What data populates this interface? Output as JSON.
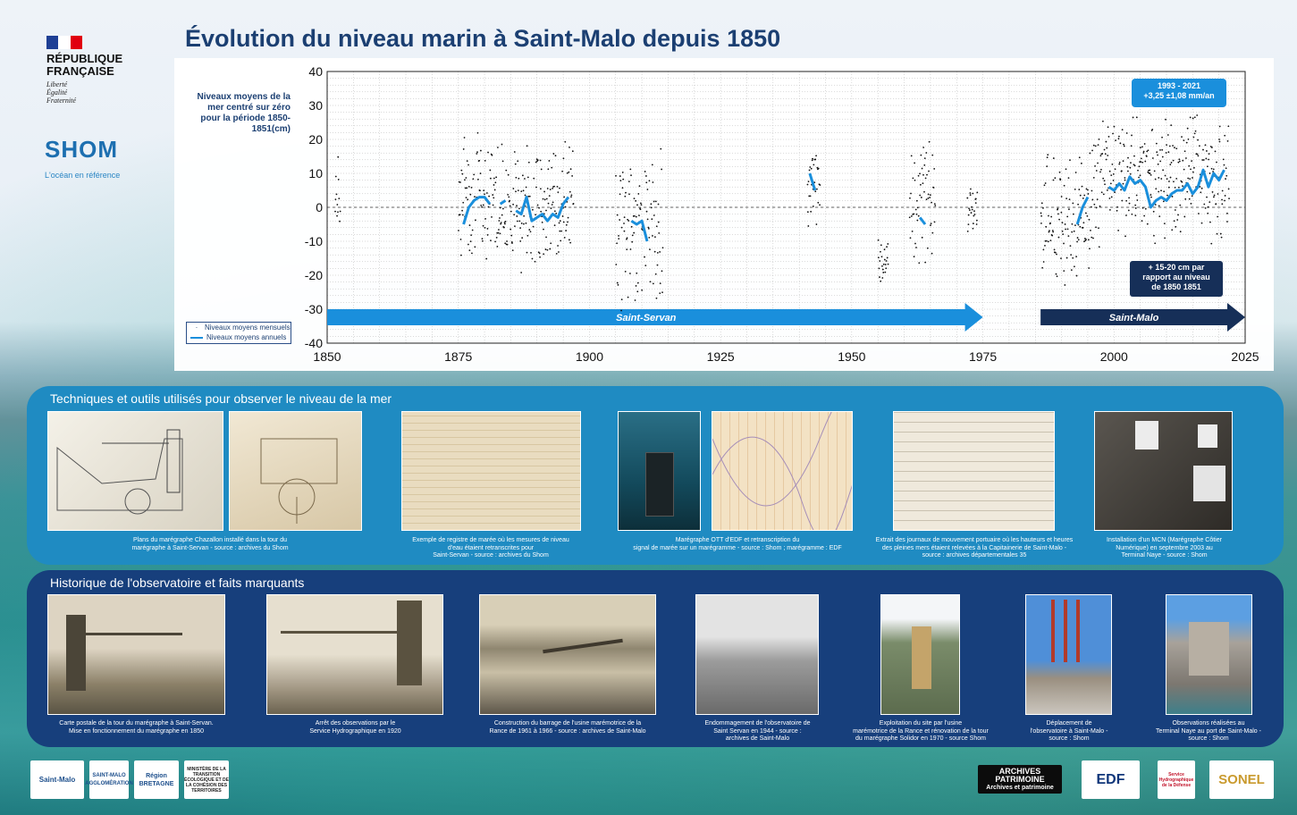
{
  "header": {
    "republique_name": "RÉPUBLIQUE\nFRANÇAISE",
    "motto": "Liberté\nÉgalité\nFraternité",
    "shom_word": "SHOM",
    "shom_tagline": "L'océan en référence",
    "title": "Évolution du niveau marin à Saint-Malo depuis 1850"
  },
  "chart_data": {
    "type": "scatter",
    "title": "Évolution du niveau marin à Saint-Malo depuis 1850",
    "ylabel": "Niveaux moyens de la mer centré sur zéro pour la période 1850-1851(cm)",
    "xlim": [
      1850,
      2025
    ],
    "ylim": [
      -40,
      40
    ],
    "xticks": [
      1850,
      1875,
      1900,
      1925,
      1950,
      1975,
      2000,
      2025
    ],
    "yticks": [
      -40,
      -30,
      -20,
      -10,
      0,
      10,
      20,
      30,
      40
    ],
    "grid": true,
    "zero_line": true,
    "legend_position": "bottom-left",
    "legend": [
      "Niveaux moyens mensuels",
      "Niveaux moyens annuels"
    ],
    "series": [
      {
        "name": "Niveaux moyens annuels",
        "kind": "line",
        "color": "#1a8fdc",
        "segments": [
          [
            [
              1876,
              -5
            ],
            [
              1877,
              0
            ],
            [
              1878,
              2
            ],
            [
              1879,
              3
            ],
            [
              1880,
              3
            ],
            [
              1881,
              1
            ]
          ],
          [
            [
              1883,
              1
            ],
            [
              1884,
              2
            ]
          ],
          [
            [
              1886,
              -1
            ],
            [
              1887,
              -2
            ],
            [
              1888,
              3
            ],
            [
              1889,
              -4
            ],
            [
              1890,
              -3
            ],
            [
              1891,
              -2
            ],
            [
              1892,
              -4
            ],
            [
              1893,
              -2
            ],
            [
              1894,
              -3
            ],
            [
              1895,
              1
            ],
            [
              1896,
              3
            ]
          ],
          [
            [
              1908,
              -4
            ],
            [
              1909,
              -5
            ],
            [
              1910,
              -4
            ],
            [
              1911,
              -10
            ]
          ],
          [
            [
              1942,
              10
            ],
            [
              1943,
              5
            ]
          ],
          [
            [
              1963,
              -3
            ],
            [
              1964,
              -5
            ]
          ],
          [
            [
              1993,
              -5
            ],
            [
              1994,
              0
            ],
            [
              1995,
              3
            ]
          ],
          [
            [
              1999,
              6
            ],
            [
              2000,
              5
            ],
            [
              2001,
              7
            ],
            [
              2002,
              5
            ],
            [
              2003,
              9
            ],
            [
              2004,
              7
            ],
            [
              2005,
              8
            ],
            [
              2006,
              6
            ],
            [
              2007,
              0
            ],
            [
              2008,
              2
            ],
            [
              2009,
              3
            ],
            [
              2010,
              2
            ],
            [
              2011,
              4
            ],
            [
              2012,
              5
            ],
            [
              2013,
              5
            ],
            [
              2014,
              7
            ],
            [
              2015,
              4
            ],
            [
              2016,
              6
            ],
            [
              2017,
              11
            ],
            [
              2018,
              6
            ],
            [
              2019,
              10
            ],
            [
              2020,
              8
            ],
            [
              2021,
              11
            ]
          ]
        ]
      },
      {
        "name": "Niveaux moyens mensuels",
        "kind": "scatter",
        "color": "#111111",
        "ranges": [
          {
            "from": 1851.5,
            "to": 1852.5,
            "min": -10,
            "max": 16
          },
          {
            "from": 1875,
            "to": 1882,
            "min": -17,
            "max": 25
          },
          {
            "from": 1882,
            "to": 1897,
            "min": -20,
            "max": 22
          },
          {
            "from": 1905,
            "to": 1914,
            "min": -32,
            "max": 20
          },
          {
            "from": 1941.5,
            "to": 1944,
            "min": -7,
            "max": 25
          },
          {
            "from": 1955,
            "to": 1957,
            "min": -24,
            "max": -8
          },
          {
            "from": 1961,
            "to": 1966,
            "min": -20,
            "max": 26
          },
          {
            "from": 1972,
            "to": 1974,
            "min": -11,
            "max": 8
          },
          {
            "from": 1986,
            "to": 1996,
            "min": -24,
            "max": 18
          },
          {
            "from": 1996,
            "to": 2022,
            "min": -12,
            "max": 30
          }
        ]
      }
    ],
    "period_bars": [
      {
        "label": "Saint-Servan",
        "from": 1850,
        "to": 1975,
        "color": "#1a8fdc"
      },
      {
        "label": "Saint-Malo",
        "from": 1986,
        "to": 2025,
        "color": "#162f58"
      }
    ],
    "annotations": [
      "1993 - 2021\n+3,25 ±1,08 mm/an",
      "+ 15-20 cm par\nrapport au niveau\nde 1850 1851"
    ]
  },
  "section1": {
    "title": "Techniques et outils utilisés pour observer le niveau de la mer",
    "captions": [
      "Plans du marégraphe Chazallon installé dans la tour du\nmarégraphe à Saint-Servan - source : archives du Shom",
      "Exemple de registre de marée où les mesures de niveau\nd'eau étaient retranscrites pour\nSaint-Servan - source : archives du Shom",
      "Marégraphe OTT d'EDF et retranscription du\nsignal de marée sur un marégramme - source : Shom ; marégramme : EDF",
      "Extrait des journaux de mouvement portuaire où les hauteurs et heures\ndes pleines mers étaient relevées à la Capitainerie de Saint-Malo -\nsource : archives départementales 35",
      "Installation d'un MCN (Marégraphe Côtier\nNumérique) en septembre 2003 au\nTerminal Naye - source : Shom"
    ]
  },
  "section2": {
    "title": "Historique de l'observatoire et faits marquants",
    "captions": [
      "Carte postale de la tour du marégraphe à Saint-Servan.\nMise en fonctionnement du  marégraphe en 1850",
      "Arrêt des observations par le\nService Hydrographique en 1920",
      "Construction du barrage de l'usine marémotrice de la\nRance de 1961 à 1966 - source : archives de Saint-Malo",
      "Endommagement de l'observatoire de\nSaint Servan en 1944 - source :\narchives de Saint-Malo",
      "Exploitation du site par l'usine\nmarémotrice de la Rance et rénovation de la tour\ndu marégraphe Solidor en 1970 - source Shom",
      "Déplacement de\nl'observatoire à Saint-Malo -\nsource : Shom",
      "Observations réalisées au\nTerminal Naye au port de Saint-Malo -\nsource : Shom"
    ]
  },
  "logos": [
    "Saint-Malo",
    "SAINT-MALO AGGLOMÉRATION",
    "Région BRETAGNE",
    "MINISTÈRE DE LA TRANSITION ÉCOLOGIQUE ET DE LA COHÉSION DES TERRITOIRES",
    "ARCHIVES PATRIMOINE",
    "Archives et patrimoine",
    "EDF",
    "Service Hydrographique de la Défense",
    "SONEL"
  ]
}
